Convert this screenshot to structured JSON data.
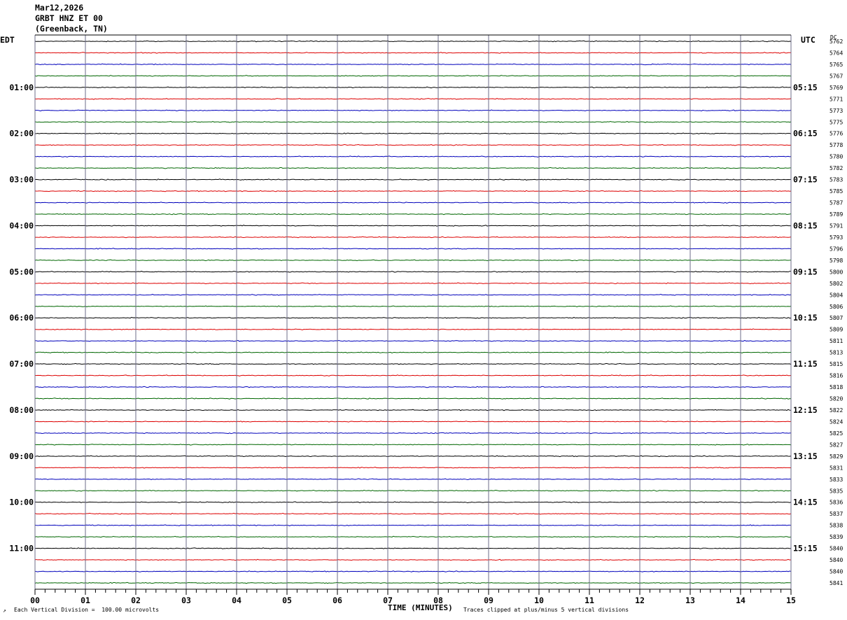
{
  "header": {
    "date": "Mar12,2026",
    "station": "GRBT HNZ ET 00",
    "location": "(Greenback, TN)"
  },
  "left_axis_title": "EDT",
  "right_axis_title": "UTC",
  "dc_label": "DC",
  "footer": {
    "scale_note": "Each Vertical Division =  100.00 microvolts",
    "xlabel": "TIME (MINUTES)",
    "clip_note": "Traces clipped at plus/minus 5 vertical divisions"
  },
  "colors": {
    "trace_cycle": [
      "#000000",
      "#dd0000",
      "#0000bb",
      "#006600"
    ],
    "grid": "#6e6e8a"
  },
  "chart_data": {
    "type": "line",
    "title": "",
    "xlabel": "TIME (MINUTES)",
    "xlim": [
      0,
      15
    ],
    "x_tick_labels": [
      "00",
      "01",
      "02",
      "03",
      "04",
      "05",
      "06",
      "07",
      "08",
      "09",
      "10",
      "11",
      "12",
      "13",
      "14",
      "15"
    ],
    "rows_per_hour": 4,
    "row_count": 48,
    "left_hour_labels": [
      "01:00",
      "02:00",
      "03:00",
      "04:00",
      "05:00",
      "06:00",
      "07:00",
      "08:00",
      "09:00",
      "10:00",
      "11:00"
    ],
    "right_hour_labels": [
      "05:15",
      "06:15",
      "07:15",
      "08:15",
      "09:15",
      "10:15",
      "11:15",
      "12:15",
      "13:15",
      "14:15",
      "15:15"
    ],
    "dc_values": [
      "5762",
      "5764",
      "5765",
      "5767",
      "5769",
      "5771",
      "5773",
      "5775",
      "5776",
      "5778",
      "5780",
      "5782",
      "5783",
      "5785",
      "5787",
      "5789",
      "5791",
      "5793",
      "5796",
      "5798",
      "5800",
      "5802",
      "5804",
      "5806",
      "5807",
      "5809",
      "5811",
      "5813",
      "5815",
      "5816",
      "5818",
      "5820",
      "5822",
      "5824",
      "5825",
      "5827",
      "5829",
      "5831",
      "5833",
      "5835",
      "5836",
      "5837",
      "5838",
      "5839",
      "5840",
      "5840",
      "5840",
      "5841"
    ]
  }
}
